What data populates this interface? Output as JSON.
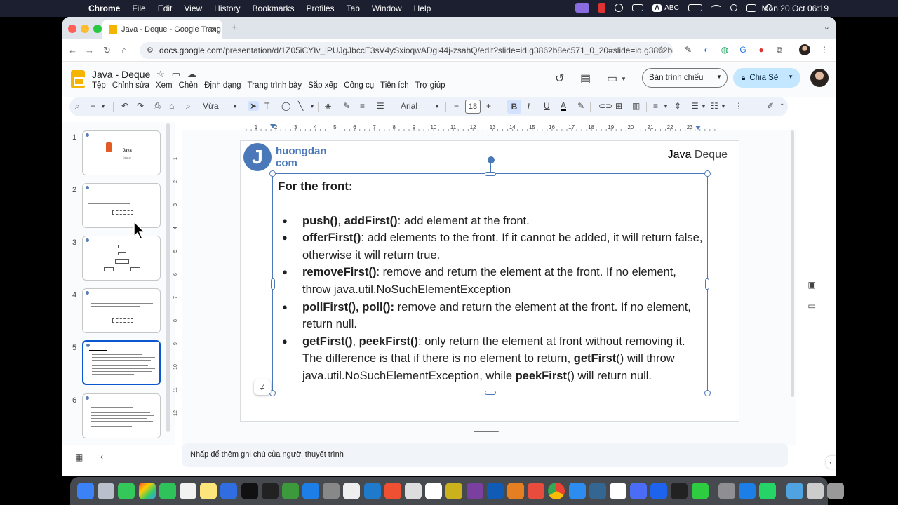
{
  "menubar": {
    "app": "Chrome",
    "items": [
      "File",
      "Edit",
      "View",
      "History",
      "Bookmarks",
      "Profiles",
      "Tab",
      "Window",
      "Help"
    ],
    "input_source": "ABC",
    "clock": "Mon 20 Oct  06:19"
  },
  "browser": {
    "tab_title": "Java - Deque - Google Trang",
    "url_host": "docs.google.com",
    "url_path": "/presentation/d/1Z05iCYIv_iPUJgJbccE3sV4ySxioqwADgi44j-zsahQ/edit?slide=id.g3862b8ec571_0_20#slide=id.g3862b8ec..."
  },
  "docs": {
    "title": "Java - Deque",
    "menus": [
      "Tệp",
      "Chỉnh sửa",
      "Xem",
      "Chèn",
      "Định dạng",
      "Trang trình bày",
      "Sắp xếp",
      "Công cụ",
      "Tiện ích",
      "Trợ giúp"
    ],
    "present_label": "Bản trình chiếu",
    "share_label": "Chia Sẻ"
  },
  "toolbar": {
    "zoom": "Vừa",
    "font": "Arial",
    "font_size": "18",
    "bold": "B",
    "italic": "I",
    "underline": "U"
  },
  "filmstrip": {
    "slides": [
      "1",
      "2",
      "3",
      "4",
      "5",
      "6"
    ],
    "active_index": 5
  },
  "ruler": {
    "top": [
      "1",
      "2",
      "3",
      "4",
      "5",
      "6",
      "7",
      "8",
      "9",
      "10",
      "11",
      "12",
      "13",
      "14",
      "15",
      "16",
      "17",
      "18",
      "19",
      "20",
      "21",
      "22",
      "23"
    ],
    "left": [
      "1",
      "2",
      "3",
      "4",
      "5",
      "6",
      "7",
      "8",
      "9",
      "10",
      "11",
      "12"
    ]
  },
  "slide": {
    "brand_letter": "J",
    "brand_line1": "huongdan",
    "brand_line2": "com",
    "heading_bold": "Java",
    "heading_light": "Deque",
    "body": {
      "heading": "For the front:",
      "items": [
        {
          "b1": "push()",
          "t1": ", ",
          "b2": "addFirst()",
          "t2": ": add element at the front."
        },
        {
          "b1": "offerFirst()",
          "t1": ": add elements to the front. If it cannot be added, it will return false, otherwise it will return true."
        },
        {
          "b1": "removeFirst()",
          "t1": ": remove and return the element at the front. If no element, throw java.util.NoSuchElementException"
        },
        {
          "b1": "pollFirst(), poll():",
          "t1": " remove and return the element at the front. If no element, return null."
        },
        {
          "b1": "getFirst()",
          "t1": ", ",
          "b2": "peekFirst()",
          "t2": ": only return the element at front without removing it. The difference is that if there is no element to return, ",
          "b3": "getFirst",
          "t3": "() will throw java.util.NoSuchElementException, while ",
          "b4": "peekFirst",
          "t4": "() will return null."
        }
      ]
    }
  },
  "thumbs": {
    "t1_title": "Java",
    "t1_sub": "Deque"
  },
  "notes_placeholder": "Nhấp để thêm ghi chú của người thuyết trình",
  "colors": {
    "accent": "#0b57d0",
    "brand_blue": "#4a78b8",
    "share_bg": "#c2e7ff",
    "slides_yellow": "#f4b400"
  }
}
